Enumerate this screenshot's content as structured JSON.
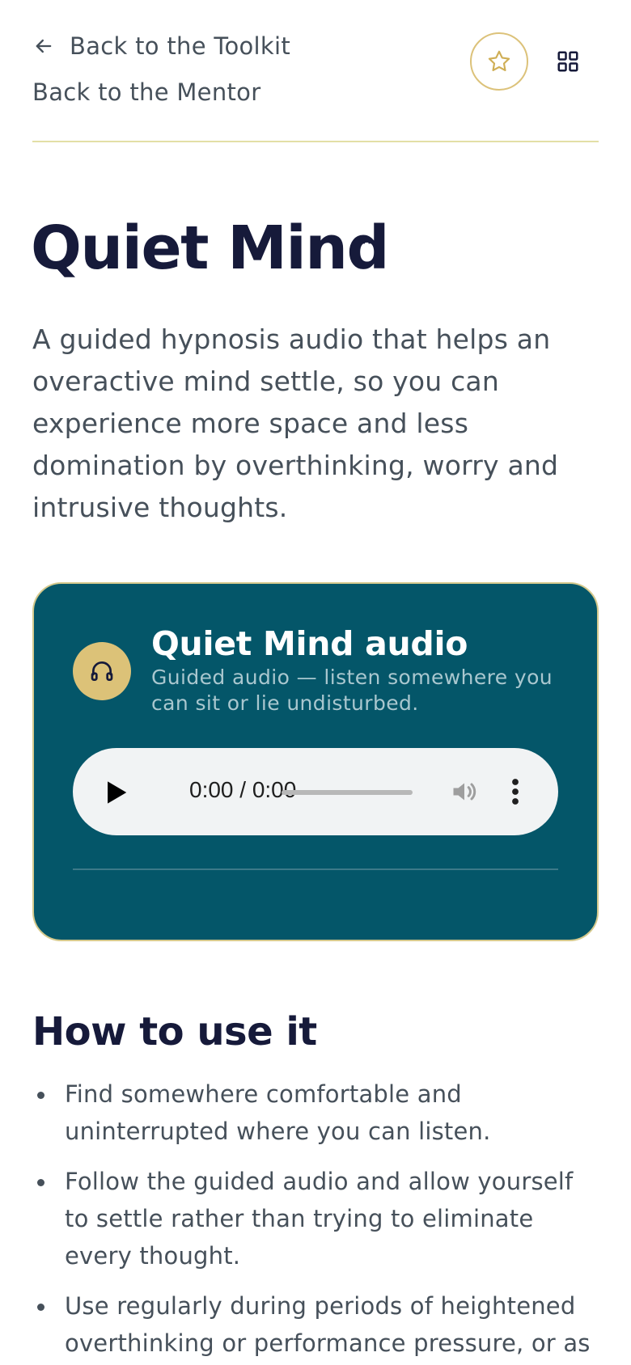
{
  "nav": {
    "back_toolkit": "Back to the Toolkit",
    "back_mentor": "Back to the Mentor",
    "icons": {
      "back": "arrow-left-icon",
      "favorite": "star-icon",
      "menu": "grid-icon"
    }
  },
  "page": {
    "title": "Quiet Mind",
    "trademark": "™",
    "intro": "A guided hypnosis audio that helps an overactive mind settle, so you can experience more space and less domination by overthinking, worry and intrusive thoughts."
  },
  "audio_card": {
    "title": "Quiet Mind audio",
    "subtitle": "Guided audio — listen somewhere you can sit or lie undisturbed.",
    "icon": "headphones-icon",
    "player": {
      "time": "0:00 / 0:00",
      "progress": 0
    }
  },
  "how_to": {
    "heading": "How to use it",
    "steps": [
      "Find somewhere comfortable and uninterrupted where you can listen.",
      "Follow the guided audio and allow yourself to settle rather than trying to eliminate every thought.",
      "Use regularly during periods of heightened overthinking or performance pressure, or as"
    ]
  },
  "colors": {
    "card_background": "#045669",
    "accent_gold": "#dcc278",
    "heading": "#161a3a",
    "body_text": "#46505a",
    "divider": "#e3dfa6"
  }
}
